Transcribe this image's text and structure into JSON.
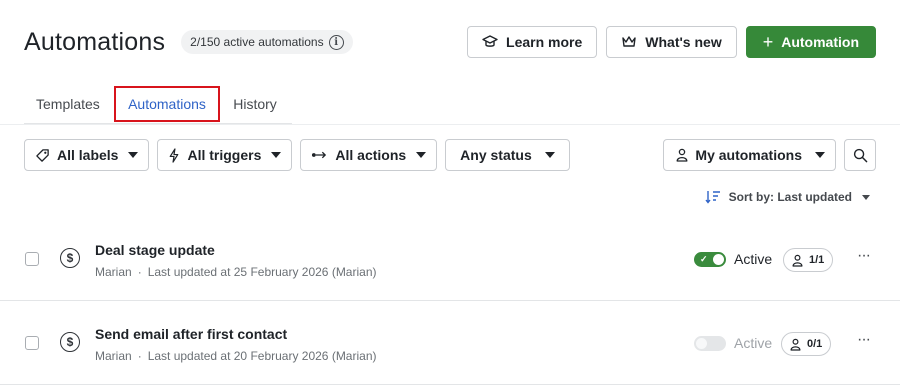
{
  "header": {
    "title": "Automations",
    "active_count": "2/150 active automations",
    "learn_more": "Learn more",
    "whats_new": "What's new",
    "add_automation": "Automation"
  },
  "tabs": [
    {
      "label": "Templates"
    },
    {
      "label": "Automations",
      "selected": true
    },
    {
      "label": "History"
    }
  ],
  "filters": {
    "labels": "All labels",
    "triggers": "All triggers",
    "actions": "All actions",
    "status": "Any status",
    "owner": "My automations"
  },
  "sort": {
    "label": "Sort by: Last updated"
  },
  "rows": [
    {
      "name": "Deal stage update",
      "owner": "Marian",
      "updated": "Last updated at 25 February 2026 (Marian)",
      "active": true,
      "status_label": "Active",
      "users": "1/1"
    },
    {
      "name": "Send email after first contact",
      "owner": "Marian",
      "updated": "Last updated at 20 February 2026 (Marian)",
      "active": false,
      "status_label": "Active",
      "users": "0/1"
    }
  ],
  "colors": {
    "primary": "#368939",
    "tab_active": "#2f63c7",
    "highlight": "#d8141c"
  }
}
